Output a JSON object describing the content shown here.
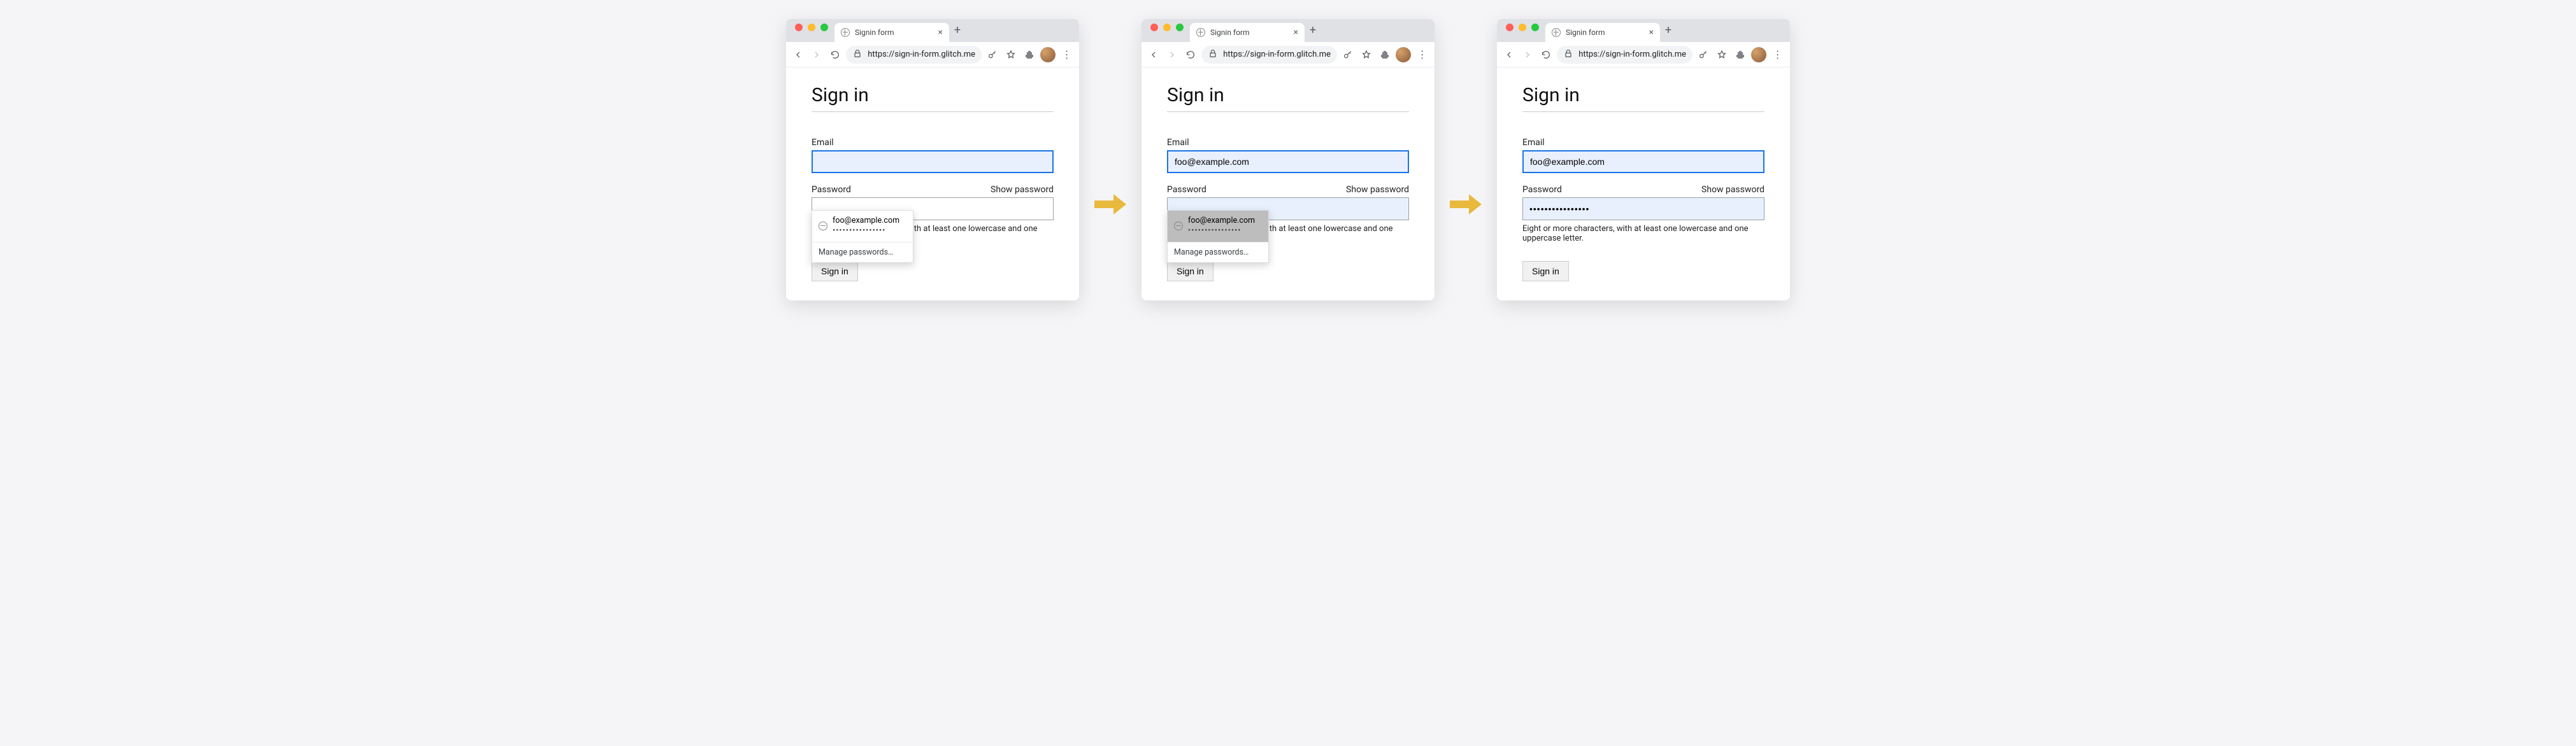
{
  "browser": {
    "tab_title": "Signin form",
    "url": "https://sign-in-form.glitch.me",
    "new_tab_plus": "+",
    "close_tab": "×",
    "menu_dots": "⋮"
  },
  "form": {
    "heading": "Sign in",
    "email_label": "Email",
    "password_label": "Password",
    "show_password": "Show password",
    "hint": "Eight or more characters, with at least one lowercase and one uppercase letter.",
    "submit": "Sign in"
  },
  "autofill": {
    "suggestion_email": "foo@example.com",
    "suggestion_password_dots": "••••••••••••••••",
    "manage": "Manage passwords…"
  },
  "state1": {
    "email_value": "",
    "password_value": ""
  },
  "state2": {
    "email_value": "foo@example.com",
    "password_value": ""
  },
  "state3": {
    "email_value": "foo@example.com",
    "password_value": "••••••••••••••••"
  }
}
